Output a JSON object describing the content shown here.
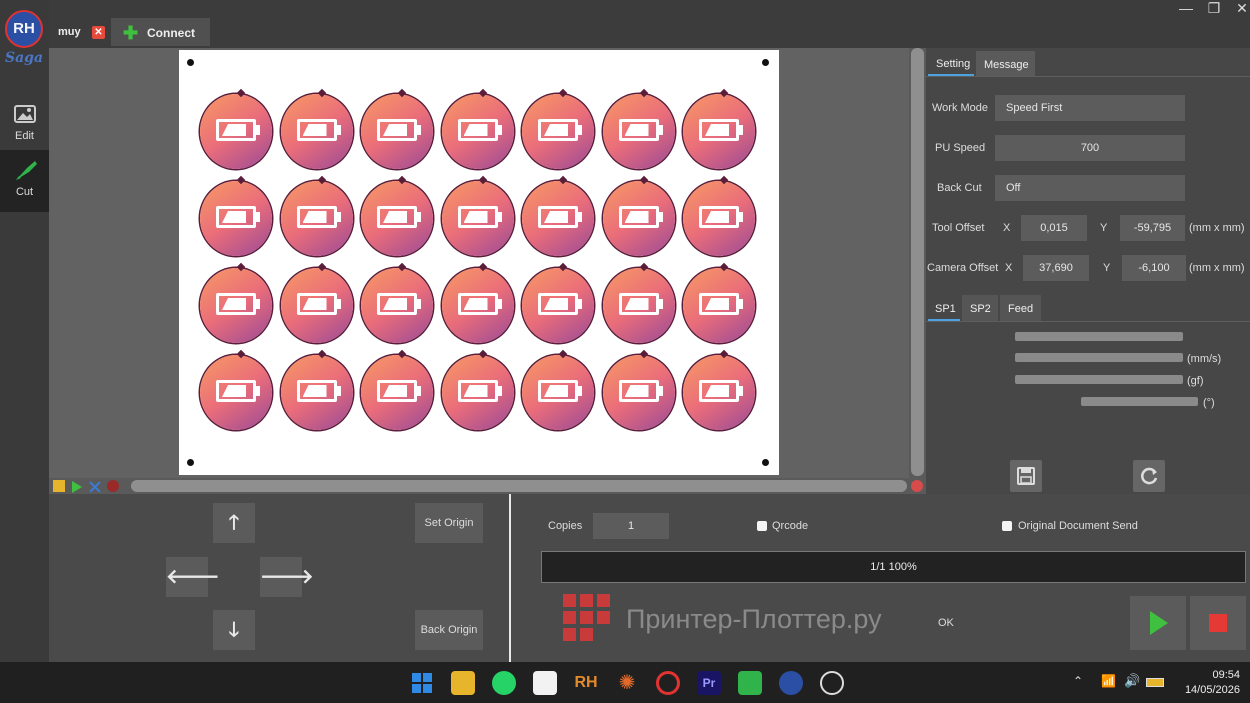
{
  "app": {
    "logo_text": "RH",
    "brand": "Saga",
    "rail": [
      {
        "label": "Edit",
        "icon": "image-icon"
      },
      {
        "label": "Cut",
        "icon": "knife-icon"
      }
    ]
  },
  "tabs": {
    "file_tab": "muy",
    "connect": "Connect"
  },
  "window_controls": [
    "minimize",
    "restore",
    "close"
  ],
  "right_panel": {
    "tabs": [
      "Setting",
      "Message"
    ],
    "work_mode": {
      "label": "Work Mode",
      "value": "Speed First"
    },
    "pu_speed": {
      "label": "PU Speed",
      "value": "700"
    },
    "back_cut": {
      "label": "Back Cut",
      "value": "Off"
    },
    "tool_offset": {
      "label": "Tool Offset",
      "x_label": "X",
      "x": "0,015",
      "y_label": "Y",
      "y": "-59,795",
      "unit": "(mm x mm)"
    },
    "camera_offset": {
      "label": "Camera Offset",
      "x_label": "X",
      "x": "37,690",
      "y_label": "Y",
      "y": "-6,100",
      "unit": "(mm x mm)"
    },
    "sub_tabs": [
      "SP1",
      "SP2",
      "Feed"
    ],
    "slider_units": [
      "(mm/s)",
      "(gf)",
      "(°)"
    ]
  },
  "canvas": {
    "rows": 4,
    "cols": 7
  },
  "controls": {
    "set_origin": "Set Origin",
    "back_origin": "Back Origin",
    "copies_label": "Copies",
    "copies_value": "1",
    "qrcode_label": "Qrcode",
    "original_doc_label": "Original Document Send",
    "progress_text": "1/1   100%",
    "progress_percent": 100,
    "watermark": "Принтер-Плоттер.ру",
    "status": "OK"
  },
  "taskbar": {
    "time": "09:54",
    "date": "14/05/2026"
  },
  "colors": {
    "accent_green": "#3fc13f",
    "stop_red": "#e53935",
    "sticker_start": "#f79a63",
    "sticker_end": "#9a4a97"
  }
}
